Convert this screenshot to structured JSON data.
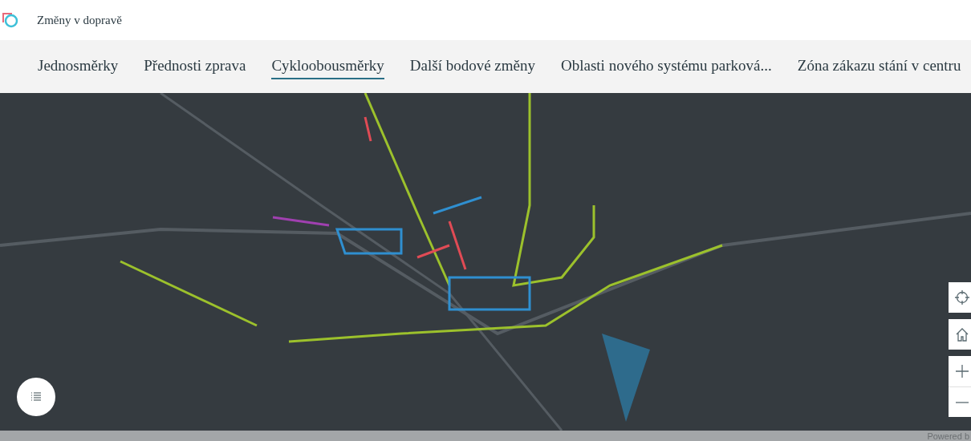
{
  "header": {
    "title": "Změny v dopravě"
  },
  "tabs": [
    {
      "label": "Jednosměrky",
      "selected": false
    },
    {
      "label": "Přednosti zprava",
      "selected": false
    },
    {
      "label": "Cykloobousměrky",
      "selected": true
    },
    {
      "label": "Další bodové změny",
      "selected": false
    },
    {
      "label": "Oblasti nového systému parková...",
      "selected": false
    },
    {
      "label": "Zóna zákazu stání v centru",
      "selected": false
    }
  ],
  "attribution": "Powered b"
}
